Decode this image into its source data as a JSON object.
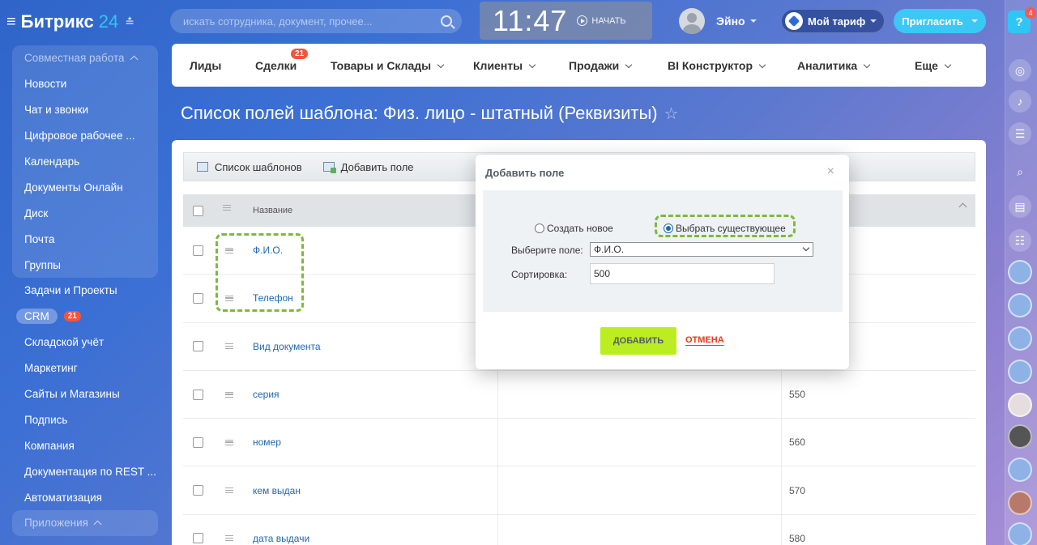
{
  "header": {
    "logo_text": "Битрикс",
    "logo_num": "24",
    "search_placeholder": "искать сотрудника, документ, прочее...",
    "clock_time": "11:47",
    "clock_start": "НАЧАТЬ",
    "user_name": "Эйно",
    "tariff_label": "Мой тариф",
    "invite_label": "Пригласить",
    "notifications_count": "4"
  },
  "sidebar": {
    "group1_title": "Совместная работа",
    "group1_items": [
      "Новости",
      "Чат и звонки",
      "Цифровое рабочее ...",
      "Календарь",
      "Документы Онлайн",
      "Диск",
      "Почта",
      "Группы"
    ],
    "items": [
      "Задачи и Проекты",
      "CRM",
      "Складской учёт",
      "Маркетинг",
      "Сайты и Магазины",
      "Подпись",
      "Компания",
      "Документация по REST ...",
      "Автоматизация"
    ],
    "crm_count": "21",
    "group2_title": "Приложения"
  },
  "crm_nav": {
    "items": [
      "Лиды",
      "Сделки",
      "Товары и Склады",
      "Клиенты",
      "Продажи",
      "BI Конструктор",
      "Аналитика",
      "Еще"
    ],
    "deals_count": "21"
  },
  "page": {
    "title": "Список полей шаблона: Физ. лицо - штатный (Реквизиты)"
  },
  "toolbar": {
    "templates_label": "Список шаблонов",
    "add_field_label": "Добавить поле"
  },
  "table": {
    "header_name": "Название",
    "rows": [
      {
        "name": "Ф.И.О.",
        "sort": ""
      },
      {
        "name": "Телефон",
        "sort": ""
      },
      {
        "name": "Вид документа",
        "sort": ""
      },
      {
        "name": "серия",
        "sort": "550"
      },
      {
        "name": "номер",
        "sort": "560"
      },
      {
        "name": "кем выдан",
        "sort": "570"
      },
      {
        "name": "дата выдачи",
        "sort": "580"
      }
    ]
  },
  "modal": {
    "title": "Добавить поле",
    "radio_new": "Создать новое",
    "radio_existing": "Выбрать существующее",
    "select_label": "Выберите поле:",
    "select_value": "Ф.И.О.",
    "sort_label": "Сортировка:",
    "sort_value": "500",
    "add_button": "ДОБАВИТЬ",
    "cancel_button": "ОТМЕНА"
  }
}
